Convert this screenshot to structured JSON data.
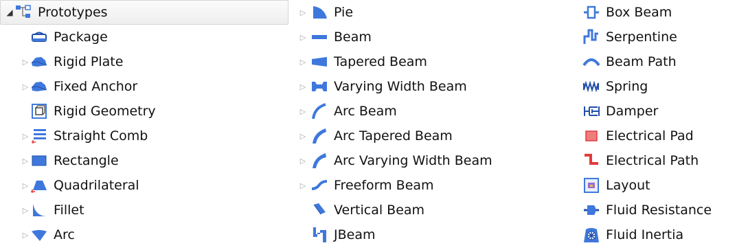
{
  "tree": {
    "root": {
      "label": "Prototypes",
      "icon": "prototypes-icon",
      "expanded": true
    },
    "column1": [
      {
        "label": "Package",
        "icon": "package-icon",
        "expandable": false
      },
      {
        "label": "Rigid Plate",
        "icon": "rigid-plate-icon",
        "expandable": true
      },
      {
        "label": "Fixed Anchor",
        "icon": "fixed-anchor-icon",
        "expandable": true
      },
      {
        "label": "Rigid Geometry",
        "icon": "rigid-geometry-icon",
        "expandable": false
      },
      {
        "label": "Straight Comb",
        "icon": "straight-comb-icon",
        "expandable": true
      },
      {
        "label": "Rectangle",
        "icon": "rectangle-icon",
        "expandable": true
      },
      {
        "label": "Quadrilateral",
        "icon": "quadrilateral-icon",
        "expandable": true
      },
      {
        "label": "Fillet",
        "icon": "fillet-icon",
        "expandable": true
      },
      {
        "label": "Arc",
        "icon": "arc-icon",
        "expandable": true
      }
    ],
    "column2": [
      {
        "label": "Pie",
        "icon": "pie-icon",
        "expandable": true
      },
      {
        "label": "Beam",
        "icon": "beam-icon",
        "expandable": true
      },
      {
        "label": "Tapered Beam",
        "icon": "tapered-beam-icon",
        "expandable": true
      },
      {
        "label": "Varying Width Beam",
        "icon": "varying-width-beam-icon",
        "expandable": true
      },
      {
        "label": "Arc Beam",
        "icon": "arc-beam-icon",
        "expandable": true
      },
      {
        "label": "Arc Tapered Beam",
        "icon": "arc-tapered-beam-icon",
        "expandable": true
      },
      {
        "label": "Arc Varying Width Beam",
        "icon": "arc-varying-width-beam-icon",
        "expandable": true
      },
      {
        "label": "Freeform Beam",
        "icon": "freeform-beam-icon",
        "expandable": true
      },
      {
        "label": "Vertical Beam",
        "icon": "vertical-beam-icon",
        "expandable": false
      },
      {
        "label": "JBeam",
        "icon": "jbeam-icon",
        "expandable": false
      }
    ],
    "column3": [
      {
        "label": "Box Beam",
        "icon": "box-beam-icon"
      },
      {
        "label": "Serpentine",
        "icon": "serpentine-icon"
      },
      {
        "label": "Beam Path",
        "icon": "beam-path-icon"
      },
      {
        "label": "Spring",
        "icon": "spring-icon"
      },
      {
        "label": "Damper",
        "icon": "damper-icon"
      },
      {
        "label": "Electrical Pad",
        "icon": "electrical-pad-icon"
      },
      {
        "label": "Electrical Path",
        "icon": "electrical-path-icon"
      },
      {
        "label": "Layout",
        "icon": "layout-icon"
      },
      {
        "label": "Fluid Resistance",
        "icon": "fluid-resistance-icon"
      },
      {
        "label": "Fluid Inertia",
        "icon": "fluid-inertia-icon"
      }
    ]
  },
  "colors": {
    "shape_blue": "#3f78dc",
    "shape_dark": "#1f4fa8",
    "electrical_red": "#e23b3b",
    "expander_gray": "#a4a4a4",
    "selection_border": "#d5d5d5"
  }
}
